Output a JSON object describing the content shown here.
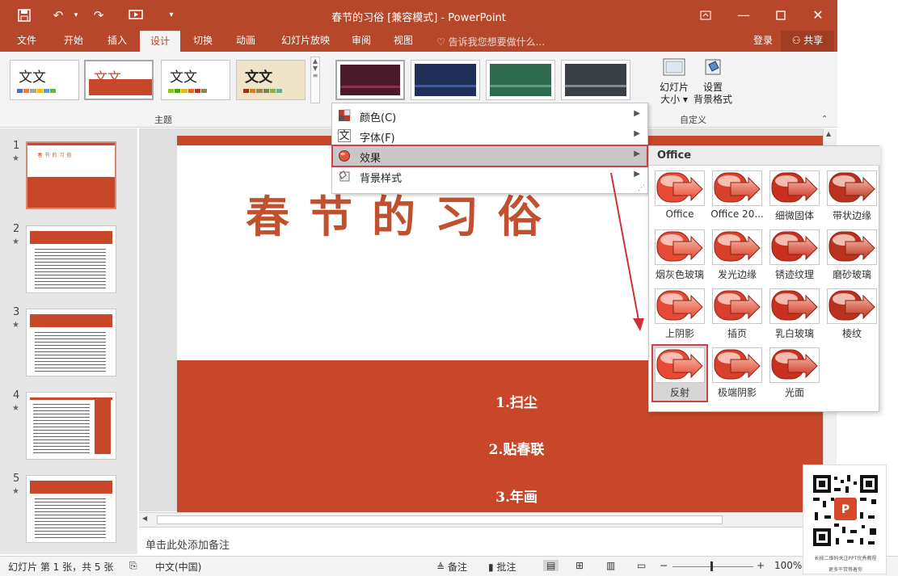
{
  "window": {
    "title": "春节的习俗 [兼容模式] - PowerPoint",
    "accent": "#b7472a"
  },
  "quick_access": [
    "save-icon",
    "undo-icon",
    "redo-icon",
    "present-icon",
    "customize-icon"
  ],
  "tabs": [
    {
      "label": "文件",
      "active": false
    },
    {
      "label": "开始",
      "active": false
    },
    {
      "label": "插入",
      "active": false
    },
    {
      "label": "设计",
      "active": true
    },
    {
      "label": "切换",
      "active": false
    },
    {
      "label": "动画",
      "active": false
    },
    {
      "label": "幻灯片放映",
      "active": false
    },
    {
      "label": "审阅",
      "active": false
    },
    {
      "label": "视图",
      "active": false
    }
  ],
  "tell_me": "告诉我您想要做什么...",
  "account": {
    "login": "登录",
    "share": "共享"
  },
  "ribbon": {
    "themes_group_label": "主题",
    "theme_thumb_text": "文文",
    "customize_group_label": "自定义",
    "slide_size_label_1": "幻灯片",
    "slide_size_label_2": "大小",
    "format_bg_label_1": "设置",
    "format_bg_label_2": "背景格式"
  },
  "variants_menu": {
    "items": [
      {
        "label": "颜色(C)",
        "icon": "color-swatch-icon"
      },
      {
        "label": "字体(F)",
        "icon": "font-icon"
      },
      {
        "label": "效果",
        "icon": "effects-icon",
        "highlighted": true
      },
      {
        "label": "背景样式",
        "icon": "background-style-icon"
      }
    ]
  },
  "effects": {
    "header": "Office",
    "items": [
      "Office",
      "Office 20...",
      "细微固体",
      "带状边缘",
      "烟灰色玻璃",
      "发光边缘",
      "锈迹纹理",
      "磨砂玻璃",
      "上阴影",
      "插页",
      "乳白玻璃",
      "棱纹",
      "反射",
      "极端阴影",
      "光面"
    ],
    "selected": "反射"
  },
  "slides": [
    {
      "num": "1"
    },
    {
      "num": "2"
    },
    {
      "num": "3"
    },
    {
      "num": "4"
    },
    {
      "num": "5"
    }
  ],
  "slide": {
    "title": "春节的习俗",
    "items": [
      "1.扫尘",
      "2.贴春联",
      "3.年画"
    ],
    "accent": "#c8472a"
  },
  "notes_placeholder": "单击此处添加备注",
  "status": {
    "slide_info": "幻灯片 第 1 张，共 5 张",
    "language": "中文(中国)",
    "notes": "备注",
    "comments": "批注",
    "zoom": "100%"
  },
  "qr": {
    "caption1": "长按二维码关注PPT优秀教程",
    "caption2": "更多干货等着你"
  }
}
